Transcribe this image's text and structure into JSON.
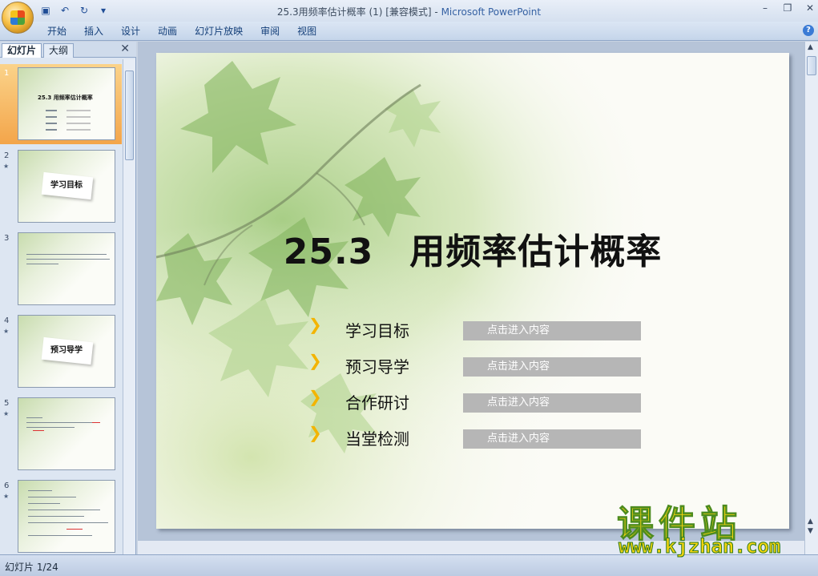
{
  "window": {
    "doc_title": "25.3用频率估计概率 (1) [兼容模式] - ",
    "app_name": "Microsoft PowerPoint"
  },
  "ribbon": {
    "tabs": [
      "开始",
      "插入",
      "设计",
      "动画",
      "幻灯片放映",
      "审阅",
      "视图"
    ]
  },
  "left_pane": {
    "tab_slides": "幻灯片",
    "tab_outline": "大纲",
    "thumbnails": [
      {
        "number": "1",
        "title": "25.3 用频率估计概率"
      },
      {
        "number": "2",
        "title": "学习目标"
      },
      {
        "number": "3",
        "title": ""
      },
      {
        "number": "4",
        "title": "预习导学"
      },
      {
        "number": "5",
        "title": ""
      },
      {
        "number": "6",
        "title": ""
      }
    ]
  },
  "slide": {
    "title": "25.3　用频率估计概率",
    "menu": [
      {
        "label": "学习目标",
        "button": "点击进入内容"
      },
      {
        "label": "预习导学",
        "button": "点击进入内容"
      },
      {
        "label": "合作研讨",
        "button": "点击进入内容"
      },
      {
        "label": "当堂检测",
        "button": "点击进入内容"
      }
    ]
  },
  "watermark": {
    "name": "课件站",
    "url": "www.kjzhan.com"
  },
  "status": {
    "slide_counter": "幻灯片 1/24"
  },
  "colors": {
    "arrow": "#f3b400",
    "button_gray": "#b6b6b6",
    "selected_thumb": "#f3a54a"
  }
}
